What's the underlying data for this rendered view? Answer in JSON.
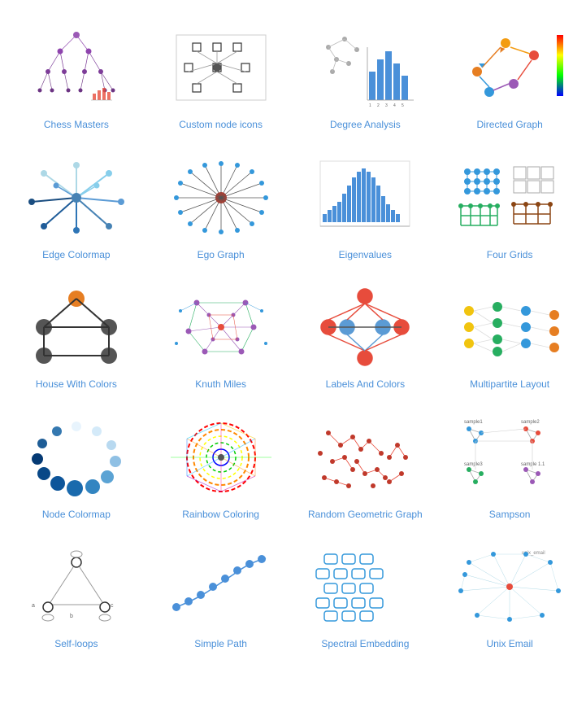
{
  "items": [
    {
      "id": "chess-masters",
      "label": "Chess Masters"
    },
    {
      "id": "custom-node-icons",
      "label": "Custom node icons"
    },
    {
      "id": "degree-analysis",
      "label": "Degree Analysis"
    },
    {
      "id": "directed-graph",
      "label": "Directed Graph"
    },
    {
      "id": "edge-colormap",
      "label": "Edge Colormap"
    },
    {
      "id": "ego-graph",
      "label": "Ego Graph"
    },
    {
      "id": "eigenvalues",
      "label": "Eigenvalues"
    },
    {
      "id": "four-grids",
      "label": "Four Grids"
    },
    {
      "id": "house-with-colors",
      "label": "House With Colors"
    },
    {
      "id": "knuth-miles",
      "label": "Knuth Miles"
    },
    {
      "id": "labels-and-colors",
      "label": "Labels And Colors"
    },
    {
      "id": "multipartite-layout",
      "label": "Multipartite Layout"
    },
    {
      "id": "node-colormap",
      "label": "Node Colormap"
    },
    {
      "id": "rainbow-coloring",
      "label": "Rainbow Coloring"
    },
    {
      "id": "random-geometric-graph",
      "label": "Random Geometric Graph"
    },
    {
      "id": "sampson",
      "label": "Sampson"
    },
    {
      "id": "self-loops",
      "label": "Self-loops"
    },
    {
      "id": "simple-path",
      "label": "Simple Path"
    },
    {
      "id": "spectral-embedding",
      "label": "Spectral Embedding"
    },
    {
      "id": "unix-email",
      "label": "Unix Email"
    }
  ]
}
